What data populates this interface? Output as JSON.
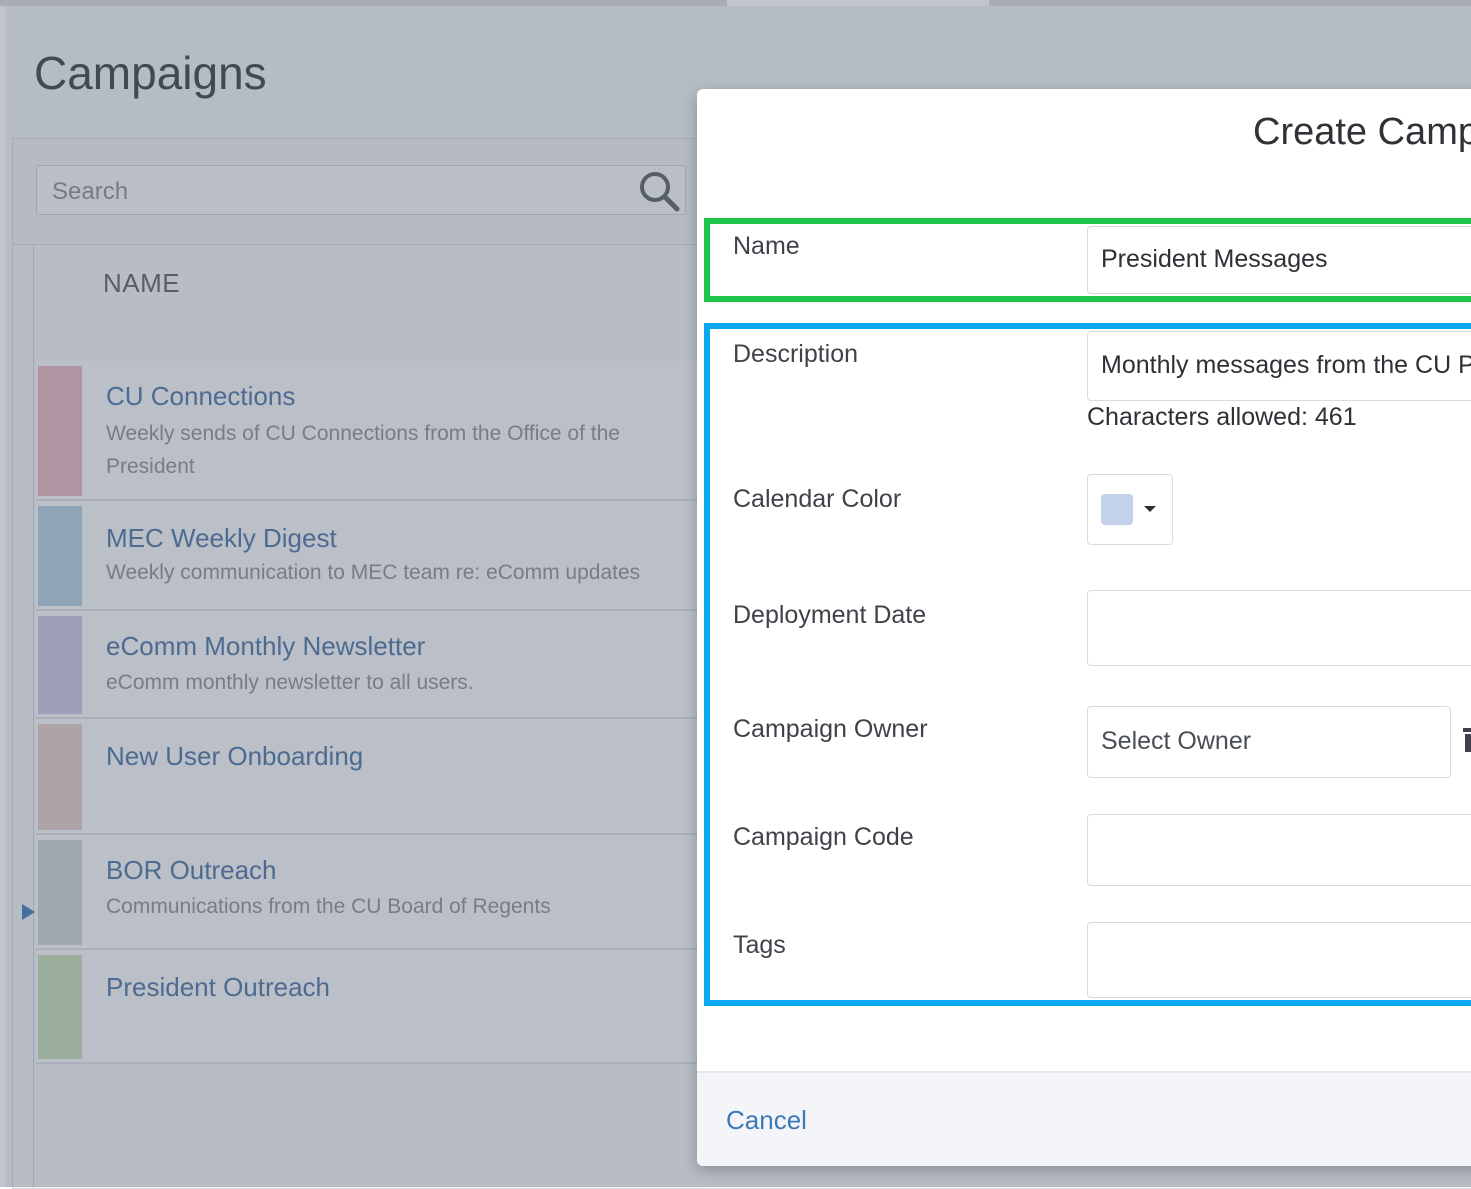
{
  "page": {
    "title": "Campaigns"
  },
  "search": {
    "placeholder": "Search"
  },
  "table": {
    "header": "NAME",
    "rows": [
      {
        "title": "CU Connections",
        "description": "Weekly sends of CU Connections from the Office of the President",
        "color": "#e3b6bd"
      },
      {
        "title": "MEC Weekly Digest",
        "description": "Weekly communication to MEC team re: eComm updates",
        "color": "#b5cde2"
      },
      {
        "title": "eComm Monthly Newsletter",
        "description": "eComm monthly newsletter to all users.",
        "color": "#cbc4e3"
      },
      {
        "title": "New User Onboarding",
        "description": "",
        "color": "#e3cbc5"
      },
      {
        "title": "BOR Outreach",
        "description": "Communications from the CU Board of Regents",
        "color": "#cdd0d2"
      },
      {
        "title": "President Outreach",
        "description": "",
        "color": "#c6dcb8"
      }
    ]
  },
  "modal": {
    "title": "Create Campaign",
    "fields": {
      "name": {
        "label": "Name",
        "value": "President Messages"
      },
      "description": {
        "label": "Description",
        "value": "Monthly messages from the CU President",
        "hint": "Characters allowed: 461"
      },
      "calendar_color": {
        "label": "Calendar Color",
        "value": "#c3d1ea"
      },
      "deployment_date": {
        "label": "Deployment Date",
        "value": ""
      },
      "campaign_owner": {
        "label": "Campaign Owner",
        "placeholder": "Select Owner"
      },
      "campaign_code": {
        "label": "Campaign Code",
        "value": ""
      },
      "tags": {
        "label": "Tags",
        "value": ""
      }
    },
    "footer": {
      "cancel_label": "Cancel"
    }
  },
  "colors": {
    "accent": "#3d7ab8",
    "highlight_green": "#1fc64a",
    "highlight_blue": "#0aa8f0"
  }
}
